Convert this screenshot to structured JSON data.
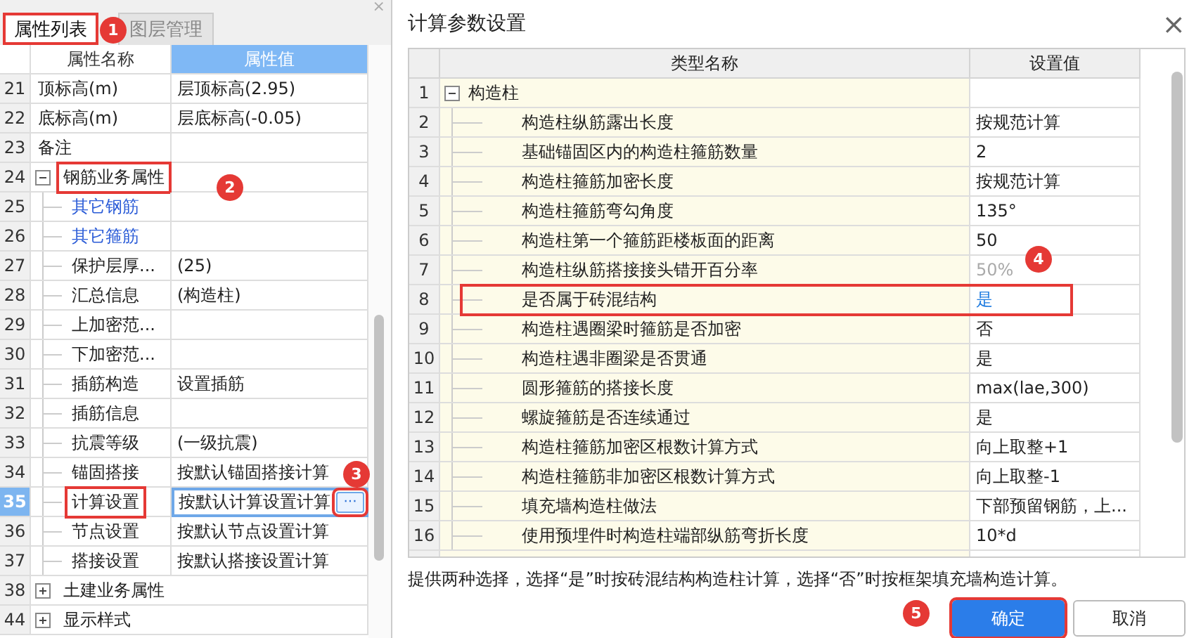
{
  "left_panel": {
    "close": "×",
    "tabs": [
      {
        "label": "属性列表",
        "selected": true,
        "boxed": true,
        "callout": "1"
      },
      {
        "label": "图层管理",
        "selected": false,
        "boxed": false
      }
    ],
    "columns": [
      "属性名称",
      "属性值"
    ],
    "rows": [
      {
        "num": "21",
        "kind": "plain",
        "name": "顶标高(m)",
        "value": "层顶标高(2.95)",
        "link": false,
        "selected": false,
        "boxed": false
      },
      {
        "num": "22",
        "kind": "plain",
        "name": "底标高(m)",
        "value": "层底标高(-0.05)",
        "link": false,
        "selected": false,
        "boxed": false
      },
      {
        "num": "23",
        "kind": "plain",
        "name": "备注",
        "value": "",
        "link": false,
        "selected": false,
        "boxed": false
      },
      {
        "num": "24",
        "kind": "group",
        "name": "钢筋业务属性",
        "expanded": true,
        "link": false,
        "selected": false,
        "boxed": true,
        "callout": "2"
      },
      {
        "num": "25",
        "kind": "child",
        "name": "其它钢筋",
        "link": true,
        "selected": false,
        "boxed": false
      },
      {
        "num": "26",
        "kind": "child",
        "name": "其它箍筋",
        "link": true,
        "selected": false,
        "boxed": false
      },
      {
        "num": "27",
        "kind": "child",
        "name": "保护层厚...",
        "value": "(25)",
        "link": false,
        "selected": false,
        "boxed": false
      },
      {
        "num": "28",
        "kind": "child",
        "name": "汇总信息",
        "value": "(构造柱)",
        "link": false,
        "selected": false,
        "boxed": false
      },
      {
        "num": "29",
        "kind": "child",
        "name": "上加密范...",
        "link": false,
        "selected": false,
        "boxed": false
      },
      {
        "num": "30",
        "kind": "child",
        "name": "下加密范...",
        "link": false,
        "selected": false,
        "boxed": false
      },
      {
        "num": "31",
        "kind": "child",
        "name": "插筋构造",
        "value": "设置插筋",
        "link": false,
        "selected": false,
        "boxed": false
      },
      {
        "num": "32",
        "kind": "child",
        "name": "插筋信息",
        "link": false,
        "selected": false,
        "boxed": false
      },
      {
        "num": "33",
        "kind": "child",
        "name": "抗震等级",
        "value": "(一级抗震)",
        "link": false,
        "selected": false,
        "boxed": false
      },
      {
        "num": "34",
        "kind": "child",
        "name": "锚固搭接",
        "value": "按默认锚固搭接计算",
        "link": false,
        "selected": false,
        "boxed": false
      },
      {
        "num": "35",
        "kind": "child",
        "name": "计算设置",
        "value": "按默认计算设置计算",
        "link": false,
        "selected": true,
        "boxed": true,
        "callout": "3",
        "more_button": "···"
      },
      {
        "num": "36",
        "kind": "child",
        "name": "节点设置",
        "value": "按默认节点设置计算",
        "link": false,
        "selected": false,
        "boxed": false
      },
      {
        "num": "37",
        "kind": "child",
        "name": "搭接设置",
        "value": "按默认搭接设置计算",
        "link": false,
        "selected": false,
        "boxed": false
      },
      {
        "num": "38",
        "kind": "group",
        "name": "土建业务属性",
        "expanded": false,
        "link": false,
        "selected": false,
        "boxed": false
      },
      {
        "num": "44",
        "kind": "group",
        "name": "显示样式",
        "expanded": false,
        "link": false,
        "selected": false,
        "boxed": false
      }
    ]
  },
  "dialog": {
    "title": "计算参数设置",
    "close": "×",
    "columns": [
      "类型名称",
      "设置值"
    ],
    "rows": [
      {
        "num": "1",
        "kind": "group",
        "name": "构造柱",
        "expanded": true,
        "value": "",
        "disabled": false,
        "edited": false,
        "boxed": false
      },
      {
        "num": "2",
        "kind": "child",
        "name": "构造柱纵筋露出长度",
        "value": "按规范计算",
        "disabled": false,
        "edited": false,
        "boxed": false
      },
      {
        "num": "3",
        "kind": "child",
        "name": "基础锚固区内的构造柱箍筋数量",
        "value": "2",
        "disabled": false,
        "edited": false,
        "boxed": false
      },
      {
        "num": "4",
        "kind": "child",
        "name": "构造柱箍筋加密长度",
        "value": "按规范计算",
        "disabled": false,
        "edited": false,
        "boxed": false
      },
      {
        "num": "5",
        "kind": "child",
        "name": "构造柱箍筋弯勾角度",
        "value": "135°",
        "disabled": false,
        "edited": false,
        "boxed": false
      },
      {
        "num": "6",
        "kind": "child",
        "name": "构造柱第一个箍筋距楼板面的距离",
        "value": "50",
        "disabled": false,
        "edited": false,
        "boxed": false
      },
      {
        "num": "7",
        "kind": "child",
        "name": "构造柱纵筋搭接接头错开百分率",
        "value": "50%",
        "disabled": true,
        "edited": false,
        "boxed": false,
        "callout": "4"
      },
      {
        "num": "8",
        "kind": "child",
        "name": "是否属于砖混结构",
        "value": "是",
        "disabled": false,
        "edited": true,
        "boxed": true
      },
      {
        "num": "9",
        "kind": "child",
        "name": "构造柱遇圈梁时箍筋是否加密",
        "value": "否",
        "disabled": false,
        "edited": false,
        "boxed": false
      },
      {
        "num": "10",
        "kind": "child",
        "name": "构造柱遇非圈梁是否贯通",
        "value": "是",
        "disabled": false,
        "edited": false,
        "boxed": false
      },
      {
        "num": "11",
        "kind": "child",
        "name": "圆形箍筋的搭接长度",
        "value": "max(lae,300)",
        "disabled": false,
        "edited": false,
        "boxed": false
      },
      {
        "num": "12",
        "kind": "child",
        "name": "螺旋箍筋是否连续通过",
        "value": "是",
        "disabled": false,
        "edited": false,
        "boxed": false
      },
      {
        "num": "13",
        "kind": "child",
        "name": "构造柱箍筋加密区根数计算方式",
        "value": "向上取整+1",
        "disabled": false,
        "edited": false,
        "boxed": false
      },
      {
        "num": "14",
        "kind": "child",
        "name": "构造柱箍筋非加密区根数计算方式",
        "value": "向上取整-1",
        "disabled": false,
        "edited": false,
        "boxed": false
      },
      {
        "num": "15",
        "kind": "child",
        "name": "填充墙构造柱做法",
        "value": "下部预留钢筋，上...",
        "disabled": false,
        "edited": false,
        "boxed": false
      },
      {
        "num": "16",
        "kind": "child",
        "name": "使用预埋件时构造柱端部纵筋弯折长度",
        "value": "10*d",
        "disabled": false,
        "edited": false,
        "boxed": false
      }
    ],
    "hint": "提供两种选择，选择“是”时按砖混结构构造柱计算，选择“否”时按框架填充墙构造计算。",
    "buttons": [
      {
        "label": "确定",
        "primary": true,
        "boxed": true,
        "callout": "5"
      },
      {
        "label": "取消",
        "primary": false,
        "boxed": false
      }
    ]
  }
}
